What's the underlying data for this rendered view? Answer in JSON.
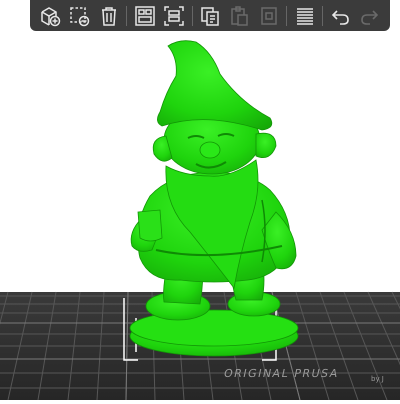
{
  "toolbar": {
    "buttons": [
      {
        "name": "add-object-button",
        "icon": "cube-plus-icon",
        "enabled": true
      },
      {
        "name": "delete-button",
        "icon": "dashed-square-minus-icon",
        "enabled": true
      },
      {
        "name": "delete-all-button",
        "icon": "trash-icon",
        "enabled": true
      },
      {
        "name": "arrange-button",
        "icon": "arrange-grid-icon",
        "enabled": true
      },
      {
        "name": "split-button",
        "icon": "split-frame-icon",
        "enabled": true
      },
      {
        "name": "copy-button",
        "icon": "copy-icon",
        "enabled": true
      },
      {
        "name": "paste-button",
        "icon": "paste-icon",
        "enabled": false
      },
      {
        "name": "add-instance-button",
        "icon": "add-instance-icon",
        "enabled": false
      },
      {
        "name": "layers-button",
        "icon": "layers-icon",
        "enabled": true
      },
      {
        "name": "undo-button",
        "icon": "undo-arrow-icon",
        "enabled": true
      },
      {
        "name": "redo-button",
        "icon": "redo-arrow-icon",
        "enabled": false
      }
    ]
  },
  "plate": {
    "label": "ORIGINAL PRUSA",
    "sublabel": "by J"
  },
  "colors": {
    "toolbar_bg": "#3b3b3b",
    "icon_enabled": "#e8e8e8",
    "icon_disabled": "#6a6a6a",
    "model_green": "#22dd10",
    "bed_dark": "#2e2e2e",
    "bed_grid": "#5a5a5a"
  }
}
